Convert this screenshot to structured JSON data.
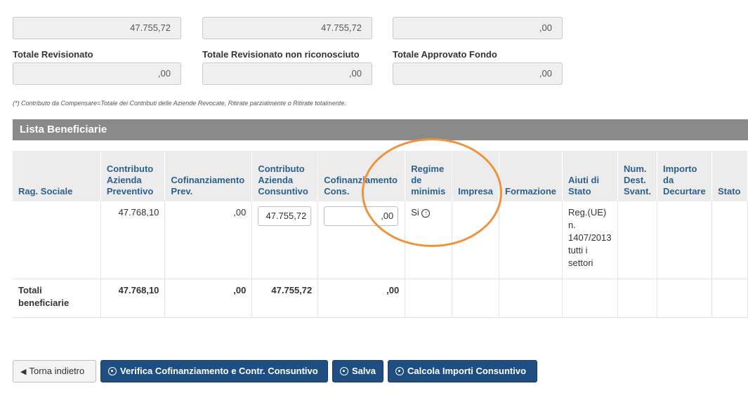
{
  "top_fields": [
    "47.755,72",
    "47.755,72",
    ",00"
  ],
  "labels": {
    "totale_revisionato": "Totale Revisionato",
    "totale_rev_non_ric": "Totale Revisionato non riconosciuto",
    "totale_approvato": "Totale Approvato Fondo"
  },
  "second_fields": [
    ",00",
    ",00",
    ",00"
  ],
  "note": "(*) Contributo da Compensare=Totale dei Contributi delle Aziende Revocate, Ritirate parzialmente o Ritirate totalmente.",
  "panel_title": "Lista Beneficiarie",
  "table": {
    "headers": [
      "Rag. Sociale",
      "Contributo Azienda Preventivo",
      "Cofinanziamento Prev.",
      "Contributo Azienda Consuntivo",
      "Cofinanziamento Cons.",
      "Regime de minimis",
      "Impresa",
      "Formazione",
      "Aiuti di Stato",
      "Num. Dest. Svant.",
      "Importo da Decurtare",
      "Stato"
    ],
    "row": {
      "rag_sociale": "",
      "contr_prev": "47.768,10",
      "cofin_prev": ",00",
      "contr_cons": "47.755,72",
      "cofin_cons": ",00",
      "regime": "Si",
      "aiuti": "Reg.(UE) n. 1407/2013 tutti i settori"
    },
    "totals": {
      "label": "Totali beneficiarie",
      "contr_prev": "47.768,10",
      "cofin_prev": ",00",
      "contr_cons": "47.755,72",
      "cofin_cons": ",00"
    }
  },
  "buttons": {
    "back": "Torna indietro",
    "verifica": "Verifica Cofinanziamento e Contr. Consuntivo",
    "salva": "Salva",
    "calcola": "Calcola Importi Consuntivo"
  },
  "colors": {
    "header_bar": "#8a8a8a",
    "button_primary": "#1f4f82",
    "highlight_ellipse": "#f0913c"
  }
}
